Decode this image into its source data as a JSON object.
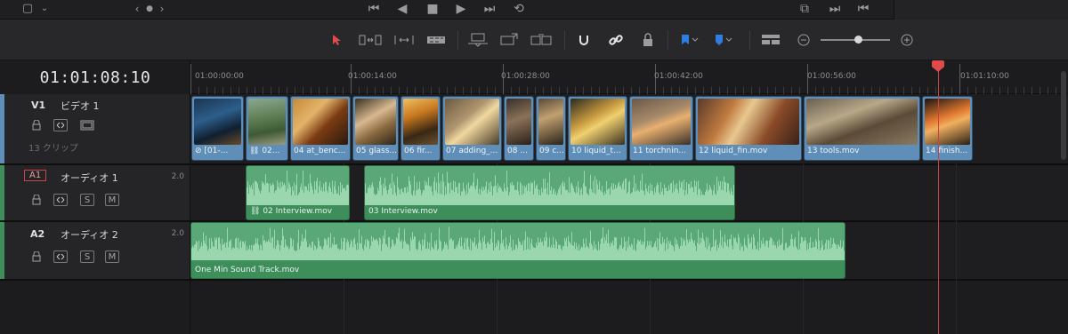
{
  "transport": {
    "icons": [
      "viewer-layout-icon",
      "chevron-down-icon",
      "prev-icon",
      "dot-icon",
      "next-icon",
      "skip-to-start-icon",
      "step-back-icon",
      "stop-icon",
      "play-icon",
      "skip-to-end-icon",
      "loop-icon",
      "monitor-icon",
      "jump-next-icon",
      "jump-prev-icon"
    ]
  },
  "toolbar": {
    "icons": [
      "selection-arrow-icon",
      "trim-edit-icon",
      "dynamic-trim-icon",
      "blade-icon",
      "insert-clip-icon",
      "overwrite-clip-icon",
      "replace-clip-icon",
      "snapping-icon",
      "linked-selection-icon",
      "position-lock-icon",
      "flag-icon",
      "marker-icon",
      "timeline-view-options-icon",
      "zoom-out-icon",
      "zoom-in-icon"
    ],
    "accent_color": "#e04a4a",
    "marker_color": "#2f7de0",
    "zoom_level": 0.5
  },
  "timecode": "01:01:08:10",
  "ruler": {
    "labels": [
      "01:00:00:00",
      "01:00:14:00",
      "01:00:28:00",
      "01:00:42:00",
      "01:00:56:00",
      "01:01:10:00"
    ]
  },
  "tracks": {
    "v1": {
      "id": "V1",
      "label": "ビデオ 1",
      "clip_count": "13 クリップ",
      "side_color": "#5f8fb9"
    },
    "a1": {
      "id": "A1",
      "label": "オーディオ 1",
      "channels": "2.0",
      "solo": "S",
      "mute": "M",
      "side_color": "#3e8e5c"
    },
    "a2": {
      "id": "A2",
      "label": "オーディオ 2",
      "channels": "2.0",
      "solo": "S",
      "mute": "M",
      "side_color": "#3e8e5c"
    }
  },
  "video_clips": [
    {
      "label": "[01-..."
    },
    {
      "label": "02..."
    },
    {
      "label": "04 at_benc..."
    },
    {
      "label": "05 glass..."
    },
    {
      "label": "06 fir..."
    },
    {
      "label": "07 adding_..."
    },
    {
      "label": "08 ..."
    },
    {
      "label": "09 c..."
    },
    {
      "label": "10 liquid_t..."
    },
    {
      "label": "11 torchnin..."
    },
    {
      "label": "12 liquid_fin.mov"
    },
    {
      "label": "13 tools.mov"
    },
    {
      "label": "14 finish..."
    }
  ],
  "audio_clips": {
    "a1": [
      {
        "label": "02 Interview.mov"
      },
      {
        "label": "03 Interview.mov"
      }
    ],
    "a2": [
      {
        "label": "One Min Sound Track.mov"
      }
    ]
  },
  "colors": {
    "video_clip": "#5f8fb9",
    "audio_clip": "#3e8e5c",
    "playhead": "#e04a4a"
  }
}
